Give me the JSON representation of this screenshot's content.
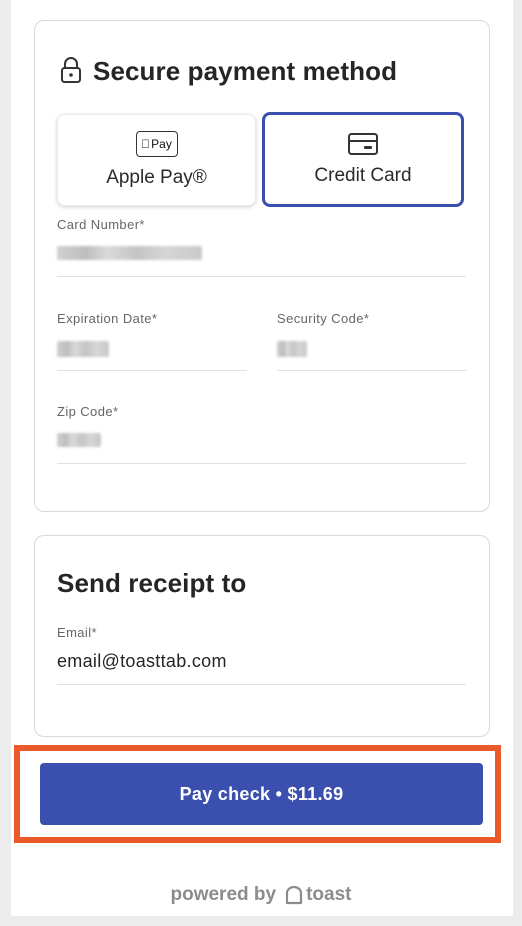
{
  "payment": {
    "title": "Secure payment method",
    "methods": {
      "apple_pay_icon_text": "Pay",
      "apple_pay_label": "Apple Pay®",
      "credit_card_label": "Credit Card",
      "selected": "Credit Card"
    },
    "fields": {
      "card_number_label": "Card Number*",
      "expiration_label": "Expiration Date*",
      "security_label": "Security Code*",
      "zip_label": "Zip Code*"
    }
  },
  "receipt": {
    "title": "Send receipt to",
    "email_label": "Email*",
    "email_value": "email@toasttab.com"
  },
  "pay_button": {
    "label": "Pay check • $11.69"
  },
  "footer": {
    "powered_by": "powered by",
    "brand": "toast"
  },
  "colors": {
    "accent": "#3b50ae",
    "selected_border": "#3a4ead",
    "highlight": "#ea5a2a"
  },
  "icons": [
    "lock-icon",
    "apple-pay-icon",
    "credit-card-icon",
    "toast-logo-icon"
  ]
}
